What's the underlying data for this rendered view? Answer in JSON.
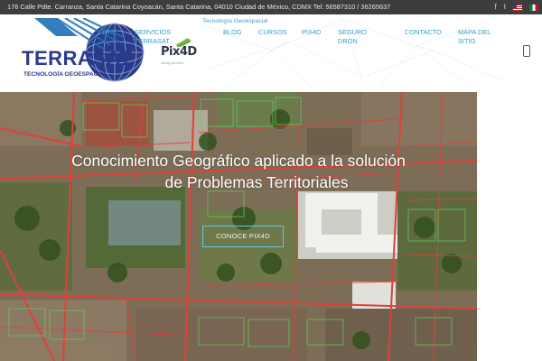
{
  "topbar": {
    "address": "176 Calle Pdte. Carranza, Santa Catarina Coyoacán, Santa Catarina, 04010 Ciudad de México, CDMX Tel: 56587310 / 36265637",
    "social_facebook": "f",
    "social_twitter": "t"
  },
  "header": {
    "brand_name": "TERRASAT",
    "brand_tagline": "TECNOLOGÍA GEOESPACIAL",
    "partner_logo": "Pix4D",
    "partner_tagline": "simply powerful",
    "submenu_label": "Tecnología Geoespacial",
    "nav": {
      "item1_line1": "TRO",
      "services_line1": "SERVICIOS",
      "services_line2": "TERRASAT",
      "blog": "BLOG",
      "cursos": "CURSOS",
      "pix4d": "PIX4D",
      "seguro_line1": "SEGURO",
      "seguro_line2": "DRON",
      "contacto": "CONTACTO",
      "mapa_line1": "MAPA DEL",
      "mapa_line2": "SITIO"
    }
  },
  "hero": {
    "title_line1": "Conocimiento Geográfico aplicado a la solución",
    "title_line2": "de Problemas Territoriales",
    "button_label": "CONOCE PIX4D"
  },
  "colors": {
    "topbar_bg": "#3d3d3d",
    "nav_link": "#2e9fd1",
    "parcel_red": "#e0403a",
    "parcel_green": "#5fd65a",
    "button_border": "#5ec8f0"
  },
  "icons": [
    "facebook-icon",
    "twitter-icon",
    "us-flag-icon",
    "mx-flag-icon",
    "mobile-menu-icon",
    "globe-icon"
  ]
}
